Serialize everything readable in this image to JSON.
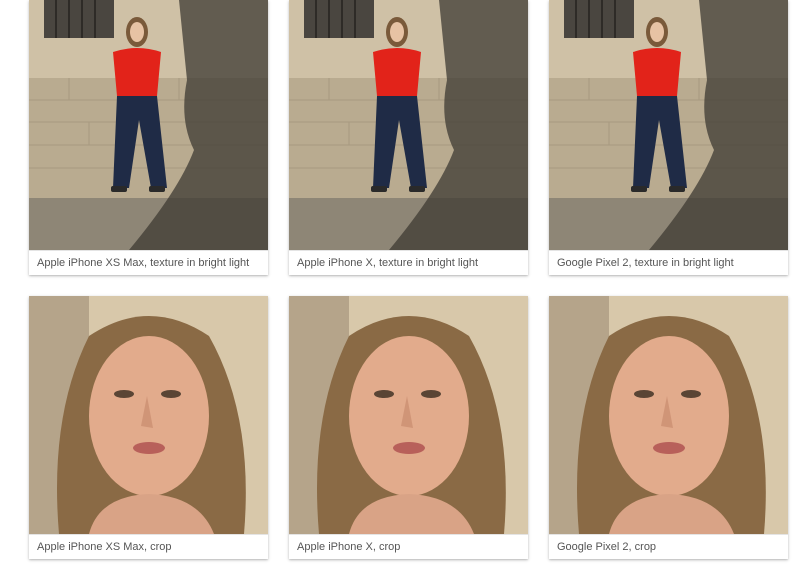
{
  "gallery": {
    "items": [
      {
        "caption": "Apple iPhone XS Max, texture in bright light"
      },
      {
        "caption": "Apple iPhone X, texture in bright light"
      },
      {
        "caption": "Google Pixel 2, texture in bright light"
      },
      {
        "caption": "Apple iPhone XS Max, crop"
      },
      {
        "caption": "Apple iPhone X, crop"
      },
      {
        "caption": "Google Pixel 2, crop"
      }
    ]
  }
}
